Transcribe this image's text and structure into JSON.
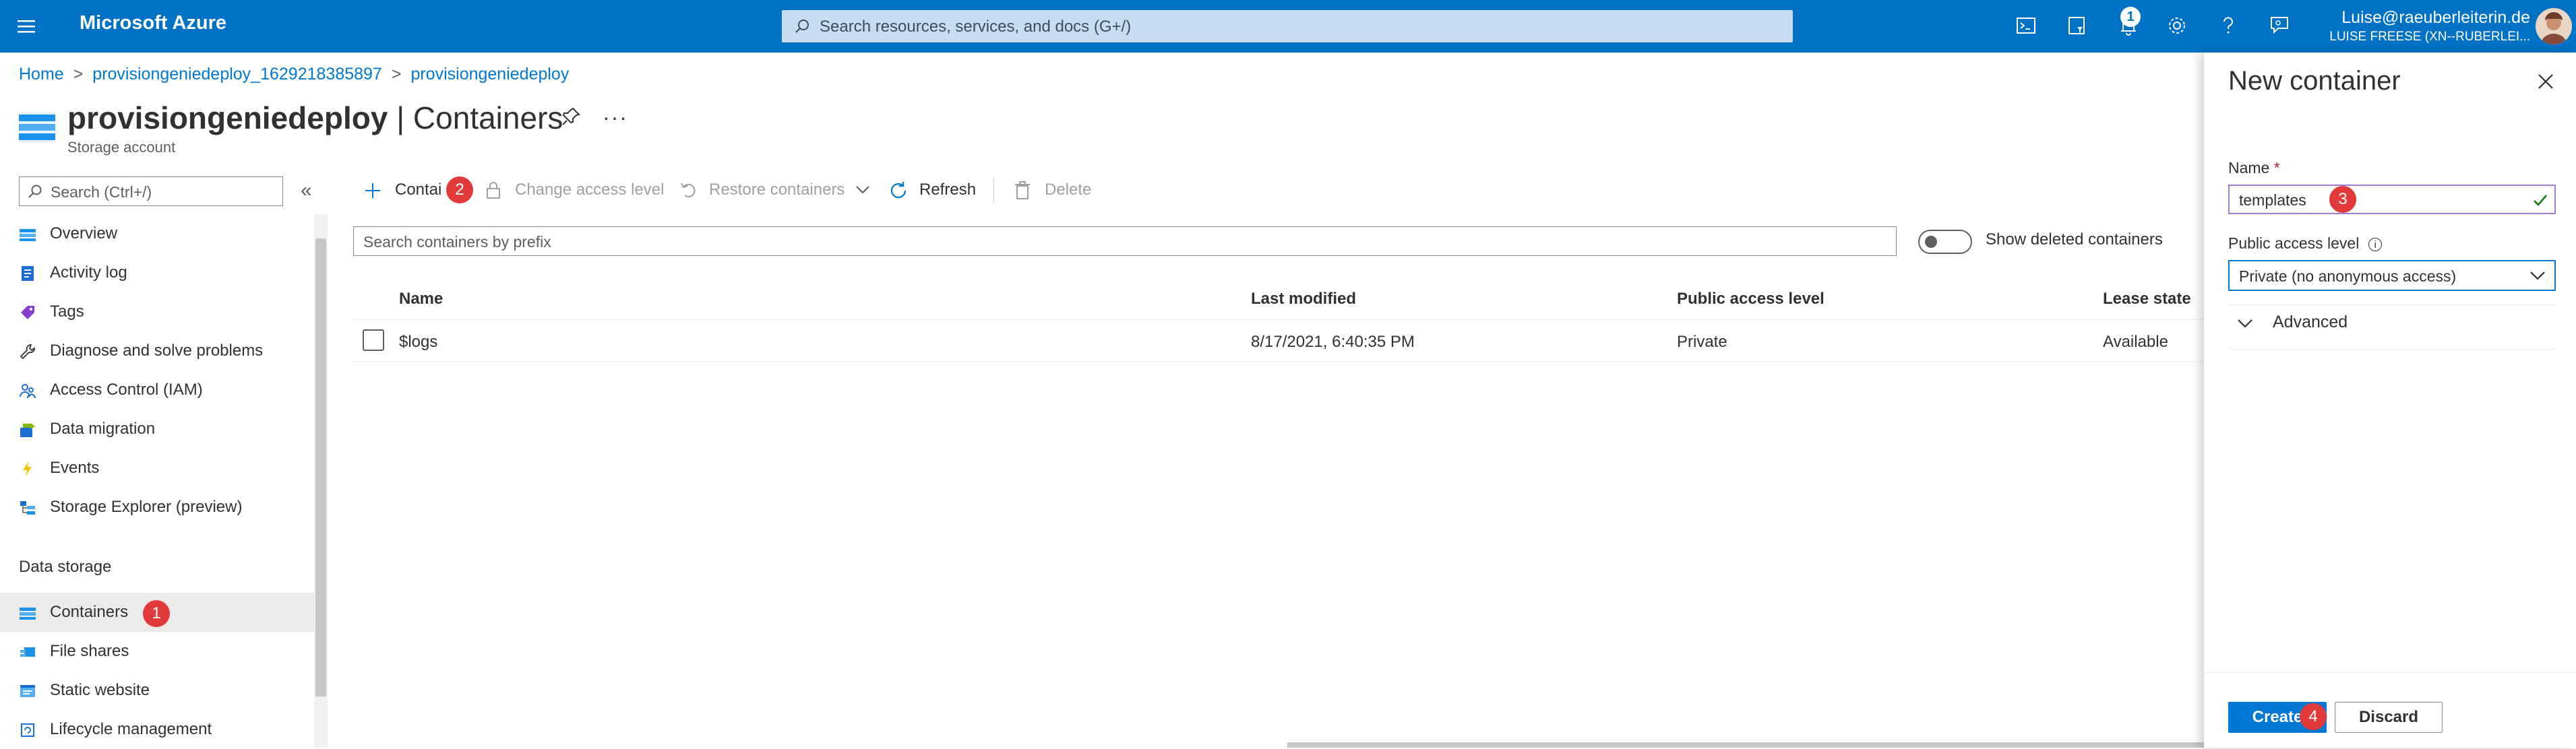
{
  "topbar": {
    "brand": "Microsoft Azure",
    "search_placeholder": "Search resources, services, and docs (G+/)",
    "notification_count": "1",
    "user_email": "Luise@raeuberleiterin.de",
    "user_tenant": "LUISE FREESE (XN--RUBERLEI...",
    "icons": [
      "menu-icon",
      "cloud-shell-icon",
      "directory-filter-icon",
      "notifications-icon",
      "settings-icon",
      "help-icon",
      "feedback-icon"
    ]
  },
  "breadcrumb": [
    "Home",
    "provisiongeniedeploy_1629218385897",
    "provisiongeniedeploy"
  ],
  "page": {
    "title_strong": "provisiongeniedeploy",
    "title_rest": " | Containers",
    "subtitle": "Storage account"
  },
  "nav": {
    "search_placeholder": "Search (Ctrl+/)",
    "items": [
      {
        "label": "Overview",
        "icon": "overview-icon"
      },
      {
        "label": "Activity log",
        "icon": "activity-log-icon"
      },
      {
        "label": "Tags",
        "icon": "tag-icon"
      },
      {
        "label": "Diagnose and solve problems",
        "icon": "wrench-icon"
      },
      {
        "label": "Access Control (IAM)",
        "icon": "people-icon"
      },
      {
        "label": "Data migration",
        "icon": "data-migration-icon"
      },
      {
        "label": "Events",
        "icon": "lightning-icon"
      },
      {
        "label": "Storage Explorer (preview)",
        "icon": "storage-explorer-icon"
      }
    ],
    "section_title": "Data storage",
    "data_items": [
      {
        "label": "Containers",
        "icon": "containers-icon",
        "active": true
      },
      {
        "label": "File shares",
        "icon": "file-shares-icon"
      },
      {
        "label": "Static website",
        "icon": "static-website-icon"
      },
      {
        "label": "Lifecycle management",
        "icon": "lifecycle-icon"
      }
    ]
  },
  "toolbar": {
    "container_label": "Contai",
    "change_access": "Change access level",
    "restore": "Restore containers",
    "refresh": "Refresh",
    "delete": "Delete"
  },
  "containers": {
    "search_placeholder": "Search containers by prefix",
    "show_deleted_label": "Show deleted containers",
    "show_deleted_on": false,
    "columns": [
      "Name",
      "Last modified",
      "Public access level",
      "Lease state"
    ],
    "rows": [
      {
        "name": "$logs",
        "last_modified": "8/17/2021, 6:40:35 PM",
        "access": "Private",
        "lease": "Available"
      }
    ]
  },
  "panel": {
    "title": "New container",
    "name_label": "Name",
    "required_mark": "*",
    "name_value": "templates",
    "access_label": "Public access level",
    "access_value": "Private (no anonymous access)",
    "advanced_label": "Advanced",
    "create_label": "Create",
    "discard_label": "Discard"
  },
  "steps": [
    "1",
    "2",
    "3",
    "4"
  ],
  "colors": {
    "azure_blue": "#0072c6",
    "accent": "#0078d4",
    "step_badge": "#e23a3a"
  }
}
